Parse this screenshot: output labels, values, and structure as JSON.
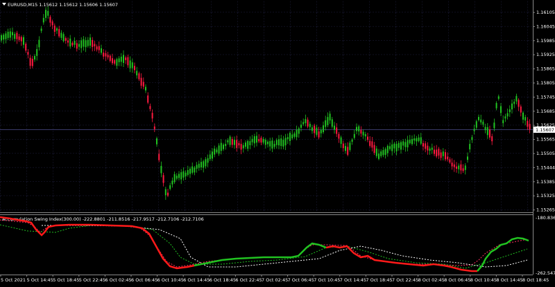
{
  "chart": {
    "symbol_header": "EURUSD,M15  1.15612 1.15612 1.15606 1.15607",
    "current_price_label": "1.15607",
    "price_axis_labels": [
      "1.16105",
      "1.16045",
      "1.15985",
      "1.15925",
      "1.15865",
      "1.15805",
      "1.15745",
      "1.15685",
      "1.15625",
      "1.15565",
      "1.15505",
      "1.15444",
      "1.15385",
      "1.15325",
      "1.15265"
    ],
    "time_axis_labels": [
      "5 Oct 2021",
      "5 Oct 14:45",
      "5 Oct 18:45",
      "5 Oct 22:45",
      "6 Oct 02:45",
      "6 Oct 06:45",
      "6 Oct 10:45",
      "6 Oct 14:45",
      "6 Oct 18:45",
      "6 Oct 22:45",
      "7 Oct 02:45",
      "7 Oct 06:45",
      "7 Oct 10:45",
      "7 Oct 14:45",
      "7 Oct 18:45",
      "7 Oct 22:45",
      "8 Oct 02:45",
      "8 Oct 06:45",
      "8 Oct 10:45",
      "8 Oct 14:45",
      "8 Oct 18:45"
    ],
    "colors": {
      "background": "#000000",
      "bull": "#21c321",
      "bear": "#ff1a40",
      "grid": "#202040",
      "axis_text": "#ffffff"
    }
  },
  "indicator": {
    "header": "Accumulation Swing Index(300.00) -222.8801 -211.8516 -217.9517 -212.7106 -212.7106",
    "axis_top": "-180.8367",
    "axis_bottom": "-262.5479"
  }
}
